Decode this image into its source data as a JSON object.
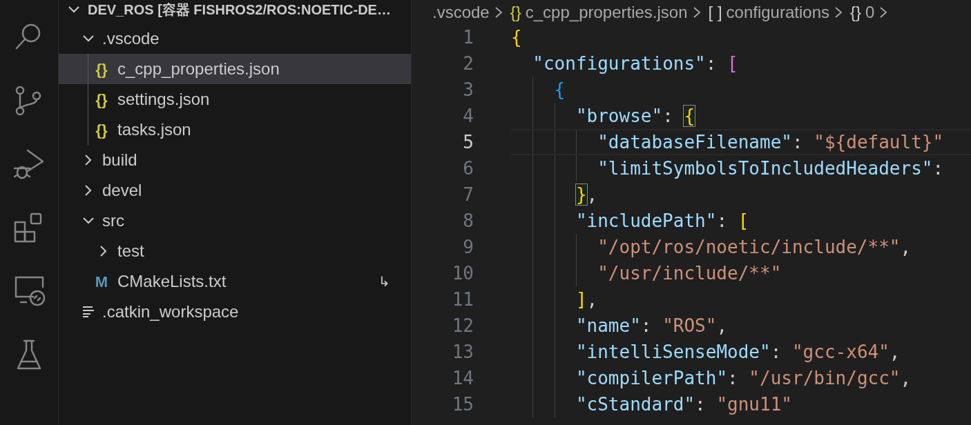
{
  "activity_bar": [
    {
      "kind": "search",
      "selected": false
    },
    {
      "kind": "source-control",
      "selected": false
    },
    {
      "kind": "run-debug",
      "selected": false
    },
    {
      "kind": "extensions",
      "selected": false
    },
    {
      "kind": "remote",
      "selected": false
    },
    {
      "kind": "testing",
      "selected": false
    }
  ],
  "explorer": {
    "root": {
      "label": "DEV_ROS [容器 FISHROS2/ROS:NOETIC-DE…",
      "expanded": true,
      "children": [
        {
          "kind": "folder",
          "label": ".vscode",
          "expanded": true,
          "selected": false,
          "children": [
            {
              "kind": "file",
              "label": "c_cpp_properties.json",
              "icon": "{}",
              "color": "#cbcb41",
              "selected": true
            },
            {
              "kind": "file",
              "label": "settings.json",
              "icon": "{}",
              "color": "#cbcb41",
              "selected": false
            },
            {
              "kind": "file",
              "label": "tasks.json",
              "icon": "{}",
              "color": "#cbcb41",
              "selected": false
            }
          ]
        },
        {
          "kind": "folder",
          "label": "build",
          "expanded": false,
          "selected": false
        },
        {
          "kind": "folder",
          "label": "devel",
          "expanded": false,
          "selected": false
        },
        {
          "kind": "folder",
          "label": "src",
          "expanded": true,
          "selected": false,
          "children": [
            {
              "kind": "folder",
              "label": "test",
              "expanded": false,
              "selected": false
            },
            {
              "kind": "file",
              "label": "CMakeLists.txt",
              "icon": "M",
              "color": "#519aba",
              "selected": false,
              "decoration": "↳"
            }
          ]
        },
        {
          "kind": "lines-file",
          "label": ".catkin_workspace",
          "selected": false
        }
      ]
    }
  },
  "breadcrumb": [
    {
      "label": ".vscode"
    },
    {
      "icon": "{}",
      "label": "c_cpp_properties.json"
    },
    {
      "icon": "[ ]",
      "label": "configurations"
    },
    {
      "icon": "{}",
      "label": "0"
    }
  ],
  "editor": {
    "lines": [
      {
        "number": "1",
        "current": false,
        "tokens": [
          {
            "t": "{",
            "kind": "bracket",
            "color": "#ffd700",
            "matched": false
          }
        ]
      },
      {
        "number": "2",
        "current": false,
        "tokens": [
          {
            "t": "\"configurations\"",
            "kind": "key"
          },
          {
            "t": ": ",
            "kind": "punct"
          },
          {
            "t": "[",
            "kind": "bracket",
            "color": "#da70d6",
            "matched": false
          }
        ]
      },
      {
        "number": "3",
        "current": false,
        "tokens": [
          {
            "t": "{",
            "kind": "bracket",
            "color": "#179fff",
            "matched": false
          }
        ]
      },
      {
        "number": "4",
        "current": false,
        "tokens": [
          {
            "t": "\"browse\"",
            "kind": "key"
          },
          {
            "t": ": ",
            "kind": "punct"
          },
          {
            "t": "{",
            "kind": "bracket",
            "color": "#ffd700",
            "matched": true
          }
        ]
      },
      {
        "number": "5",
        "current": true,
        "tokens": [
          {
            "t": "\"databaseFilename\"",
            "kind": "key"
          },
          {
            "t": ": ",
            "kind": "punct"
          },
          {
            "t": "\"${default}\"",
            "kind": "string"
          }
        ]
      },
      {
        "number": "6",
        "current": false,
        "tokens": [
          {
            "t": "\"limitSymbolsToIncludedHeaders\"",
            "kind": "key"
          },
          {
            "t": ":",
            "kind": "punct"
          }
        ]
      },
      {
        "number": "7",
        "current": false,
        "tokens": [
          {
            "t": "}",
            "kind": "bracket",
            "color": "#ffd700",
            "matched": true
          },
          {
            "t": ",",
            "kind": "punct"
          }
        ]
      },
      {
        "number": "8",
        "current": false,
        "tokens": [
          {
            "t": "\"includePath\"",
            "kind": "key"
          },
          {
            "t": ": ",
            "kind": "punct"
          },
          {
            "t": "[",
            "kind": "bracket",
            "color": "#ffd700",
            "matched": false
          }
        ]
      },
      {
        "number": "9",
        "current": false,
        "tokens": [
          {
            "t": "\"/opt/ros/noetic/include/**\"",
            "kind": "string"
          },
          {
            "t": ",",
            "kind": "punct"
          }
        ]
      },
      {
        "number": "10",
        "current": false,
        "tokens": [
          {
            "t": "\"/usr/include/**\"",
            "kind": "string"
          }
        ]
      },
      {
        "number": "11",
        "current": false,
        "tokens": [
          {
            "t": "]",
            "kind": "bracket",
            "color": "#ffd700",
            "matched": false
          },
          {
            "t": ",",
            "kind": "punct"
          }
        ]
      },
      {
        "number": "12",
        "current": false,
        "tokens": [
          {
            "t": "\"name\"",
            "kind": "key"
          },
          {
            "t": ": ",
            "kind": "punct"
          },
          {
            "t": "\"ROS\"",
            "kind": "string"
          },
          {
            "t": ",",
            "kind": "punct"
          }
        ]
      },
      {
        "number": "13",
        "current": false,
        "tokens": [
          {
            "t": "\"intelliSenseMode\"",
            "kind": "key"
          },
          {
            "t": ": ",
            "kind": "punct"
          },
          {
            "t": "\"gcc-x64\"",
            "kind": "string"
          },
          {
            "t": ",",
            "kind": "punct"
          }
        ]
      },
      {
        "number": "14",
        "current": false,
        "tokens": [
          {
            "t": "\"compilerPath\"",
            "kind": "key"
          },
          {
            "t": ": ",
            "kind": "punct"
          },
          {
            "t": "\"/usr/bin/gcc\"",
            "kind": "string"
          },
          {
            "t": ",",
            "kind": "punct"
          }
        ]
      },
      {
        "number": "15",
        "current": false,
        "tokens": [
          {
            "t": "\"cStandard\"",
            "kind": "key"
          },
          {
            "t": ": ",
            "kind": "punct"
          },
          {
            "t": "\"gnu11\"",
            "kind": "string"
          }
        ]
      }
    ]
  }
}
